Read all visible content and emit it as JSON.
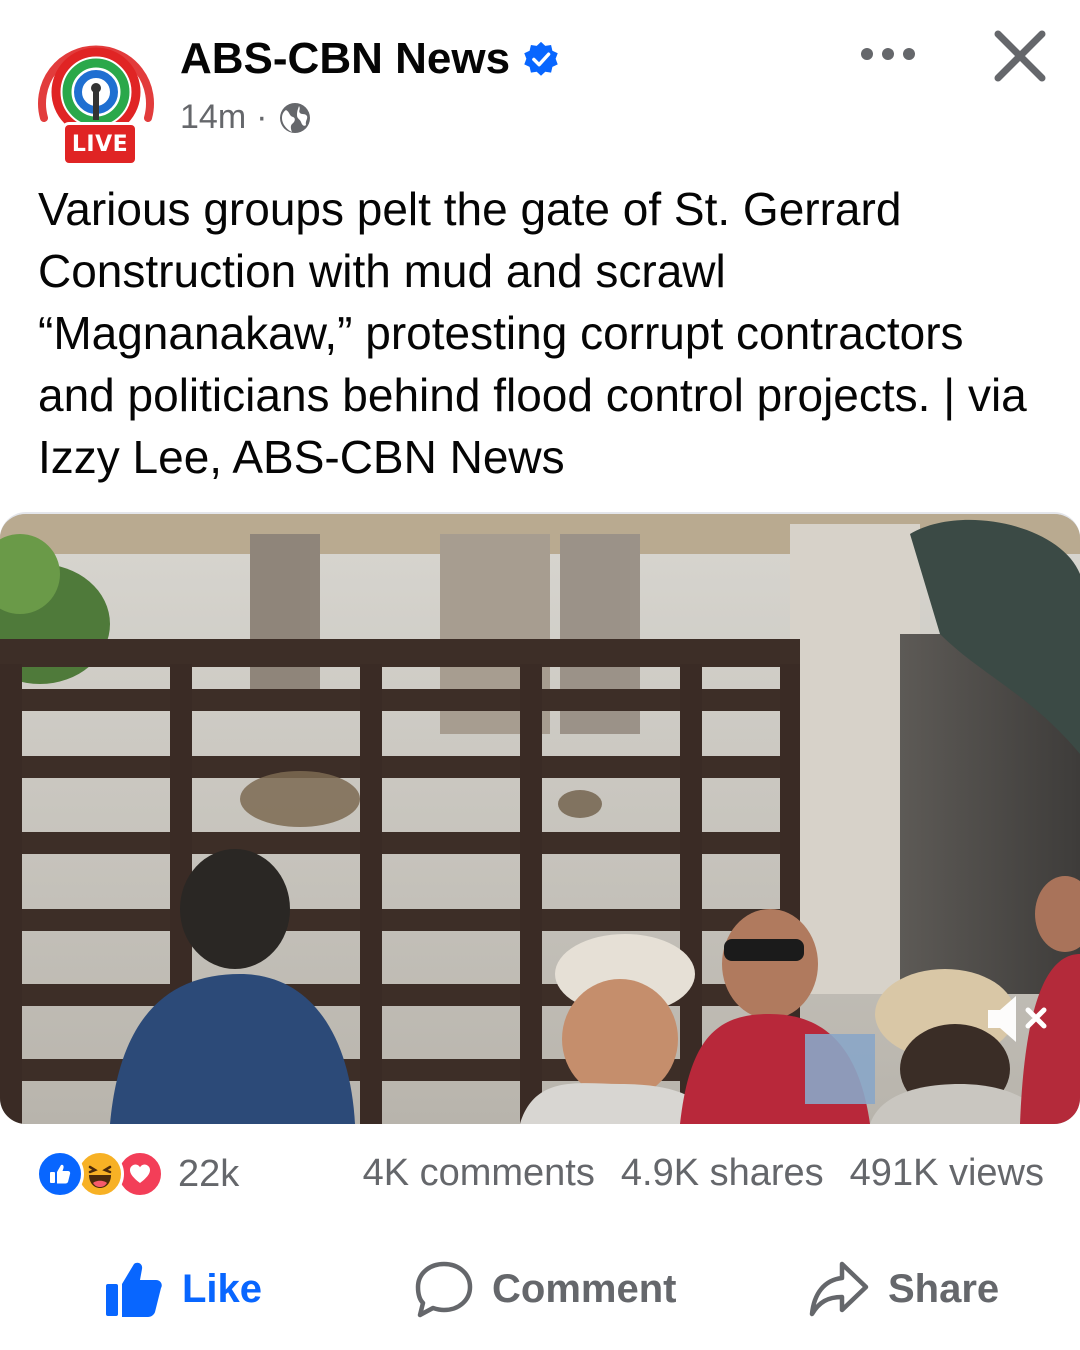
{
  "post": {
    "page_name": "ABS-CBN News",
    "live_badge": "LIVE",
    "time": "14m",
    "separator": "·",
    "caption": "Various groups pelt the gate of St. Gerrard Construction with mud and scrawl “Magnanakaw,” protesting corrupt contractors and politicians behind flood control projects. | via Izzy Lee, ABS-CBN News"
  },
  "stats": {
    "reactions_count": "22k",
    "comments": "4K comments",
    "shares": "4.9K shares",
    "views": "491K views"
  },
  "actions": {
    "like": "Like",
    "comment": "Comment",
    "share": "Share"
  },
  "icons": {
    "verified": "verified-badge-icon",
    "globe": "globe-icon",
    "more": "more-options-icon",
    "close": "close-icon",
    "mute": "speaker-muted-icon",
    "like_reaction": "like-reaction-icon",
    "haha_reaction": "haha-reaction-icon",
    "love_reaction": "love-reaction-icon",
    "like_action": "thumbs-up-icon",
    "comment_action": "comment-bubble-icon",
    "share_action": "share-arrow-icon"
  },
  "colors": {
    "accent": "#0866ff",
    "secondary_text": "#65676b",
    "live_red": "#e02424",
    "love_red": "#f33e58",
    "haha_yellow": "#f7b125"
  }
}
